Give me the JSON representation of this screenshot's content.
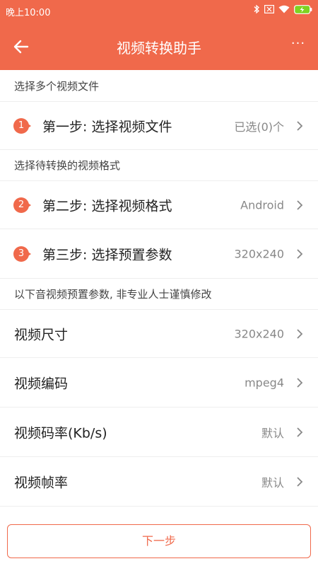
{
  "status_bar": {
    "time": "晚上10:00",
    "icons": [
      "bluetooth-icon",
      "sim-icon",
      "wifi-icon",
      "battery-charging-icon"
    ]
  },
  "app_bar": {
    "title": "视频转换助手",
    "more": "···",
    "back_icon": "arrow-left-icon",
    "accent_color": "#F0694B"
  },
  "sections": {
    "select_files": "选择多个视频文件",
    "select_format": "选择待转换的视频格式",
    "preset_note": "以下音视频预置参数, 非专业人士谨慎修改"
  },
  "steps": [
    {
      "badge": "1",
      "label": "第一步: 选择视频文件",
      "value": "已选(0)个"
    },
    {
      "badge": "2",
      "label": "第二步: 选择视频格式",
      "value": "Android"
    },
    {
      "badge": "3",
      "label": "第三步: 选择预置参数",
      "value": "320x240"
    }
  ],
  "params": [
    {
      "label": "视频尺寸",
      "value": "320x240"
    },
    {
      "label": "视频编码",
      "value": "mpeg4"
    },
    {
      "label": "视频码率(Kb/s)",
      "value": "默认"
    },
    {
      "label": "视频帧率",
      "value": "默认"
    }
  ],
  "next_button": "下一步"
}
